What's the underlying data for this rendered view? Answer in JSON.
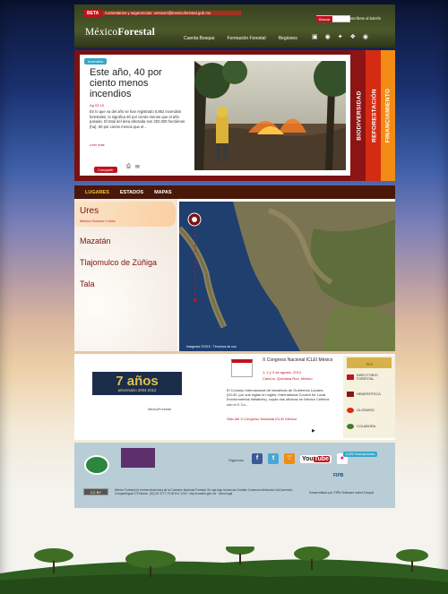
{
  "header": {
    "beta_label": "BETA",
    "beta_message": "Comentarios y sugerencias: version3@mexicoforestal.gob.mx",
    "logo_light": "México",
    "logo_bold": "Forestal",
    "search_button": "Buscar",
    "subscribe": "Suscríbete al boletín",
    "nav": [
      "Cuenta Bosque",
      "Formación Forestal",
      "Regiones"
    ],
    "tool_icons": [
      "video-icon",
      "camera-icon",
      "podcast-icon",
      "gallery-icon",
      "rss-icon"
    ]
  },
  "featured": {
    "tag": "Incendios",
    "title": "Este año, 40 por ciento menos incendios",
    "date": "Ag 03 10",
    "summary": "En lo que va del año se han registrado 6,862 incendios forestales, lo significa 40 por ciento menos que el año pasado. El total del área afectada son 202,000 hectáreas (ha), 60 por ciento menos que el...",
    "more": "Leer más",
    "share": "Compartir",
    "side_tabs": [
      "BIODIVERSIDAD",
      "REFORESTACIÓN",
      "FINANCIAMIENTO"
    ],
    "colors": {
      "tab1": "#8d1414",
      "tab2": "#d62b13",
      "tab3": "#f28c14",
      "frame": "#7a1212"
    }
  },
  "places": {
    "tabs": [
      "LUGARES",
      "ESTADOS",
      "MAPAS"
    ],
    "selected": {
      "name": "Ures",
      "breadcrumb": "México Sonora » Ures"
    },
    "items": [
      "Mazatán",
      "Tlajomulco de Zúñiga",
      "Tala"
    ],
    "map_caption": "Imágenes ©2010 · Términos de uso"
  },
  "events": {
    "anniversary_number": "7 años",
    "anniversary_text": "aniversario 2004-2012",
    "anniversary_logo": "MéxicoForestal",
    "event_title": "X Congreso Nacional ICLEI México",
    "event_date": "1, 2 y 3 de agosto, 2012",
    "event_place": "Cancún, Quintana Roo, México",
    "event_body": "El Consejo Internacional de Iniciativas de Gobiernos Locales (ICLEI, por sus siglas en inglés: International Council for Local Environmental Initiatives), cuyas dos oficinas en México Celebra con el X Co...",
    "event_link": "Sitio del X Congreso Nacional ICLEI México",
    "side_header": "TIPS",
    "side_items": [
      "DIRECTORIO FORESTAL",
      "HEMEROTECA",
      "GLOSARIO",
      "COLABORA"
    ]
  },
  "footer": {
    "follow_label": "Síguenos",
    "social": [
      "facebook-icon",
      "twitter-icon",
      "rss-icon",
      "youtube-icon",
      "flickr-icon"
    ],
    "youtube_label": "You",
    "youtube_tube": "Tube",
    "subscriptions": "5,000 Suscripciones",
    "fipb": "FIPB",
    "cc_label": "CC BY",
    "legal": "México Forestal (e) revista electrónica de la Comisión Nacional Forestal. Se rige bajo la licencia Creative Commons Atribución-NoComercial-CompartirIgual 2.5 México. (52) 33 3777-70-00 Ext. 1234 · http://conafor.gob.mx · Aviso legal",
    "developer": "Desarrollado por FIPb Software sobre Drupal"
  }
}
